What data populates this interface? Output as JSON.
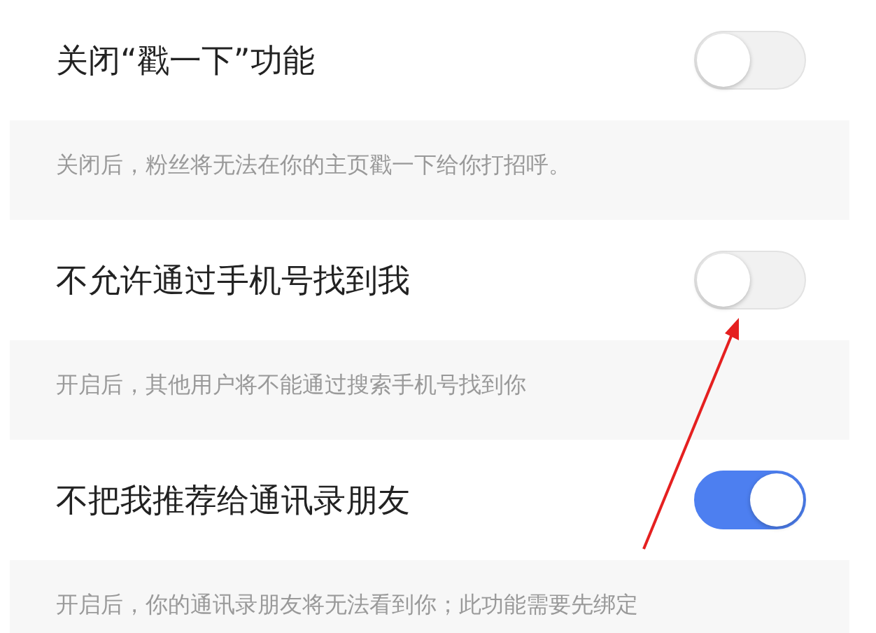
{
  "settings": [
    {
      "label": "关闭“戳一下”功能",
      "on": false,
      "description": "关闭后，粉丝将无法在你的主页戳一下给你打招呼。"
    },
    {
      "label": "不允许通过手机号找到我",
      "on": false,
      "description": "开启后，其他用户将不能通过搜索手机号找到你"
    },
    {
      "label": "不把我推荐给通讯录朋友",
      "on": true,
      "description": "开启后，你的通讯录朋友将无法看到你；此功能需要先绑定"
    }
  ]
}
